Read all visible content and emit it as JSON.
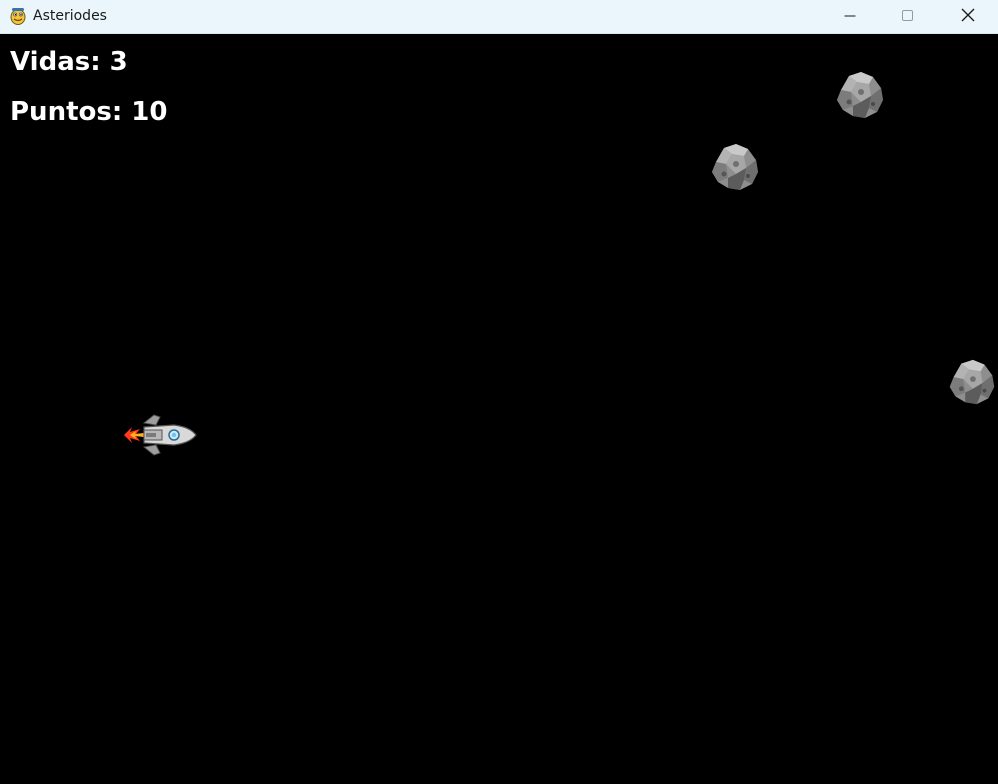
{
  "window": {
    "title": "Asteriodes",
    "icons": {
      "app": "python-snake-icon",
      "minimize": "minimize-icon",
      "maximize": "maximize-icon",
      "close": "close-icon"
    }
  },
  "hud": {
    "lives_text": "Vidas: 3",
    "score_text": "Puntos: 10"
  },
  "game": {
    "background_color": "#000000",
    "player": "rocket-ship",
    "asteroid_count": 3
  }
}
